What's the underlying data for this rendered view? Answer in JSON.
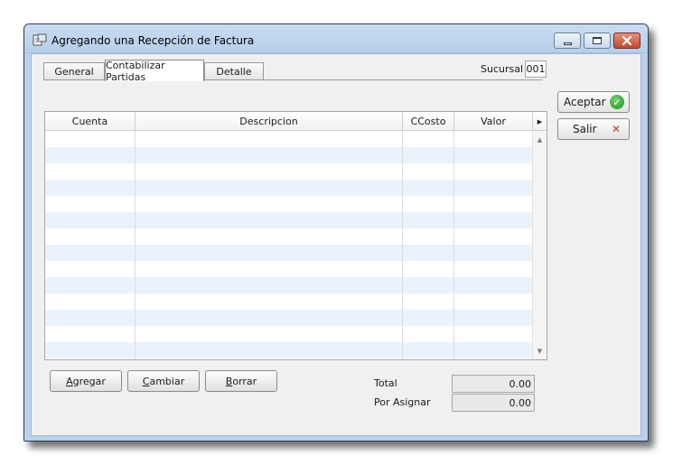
{
  "window": {
    "title": "Agregando una Recepción de Factura"
  },
  "tabs": [
    {
      "label": "General",
      "active": false
    },
    {
      "label": "Contabilizar Partidas",
      "active": true
    },
    {
      "label": "Detalle",
      "active": false
    }
  ],
  "sucursal": {
    "label": "Sucursal",
    "value": "001"
  },
  "actions": {
    "accept_label": "Aceptar",
    "exit_label": "Salir"
  },
  "grid": {
    "columns": [
      "Cuenta",
      "Descripcion",
      "CCosto",
      "Valor"
    ],
    "rows": []
  },
  "buttons": {
    "add": {
      "access_key": "A",
      "rest": "gregar"
    },
    "change": {
      "access_key": "C",
      "rest": "ambiar"
    },
    "delete": {
      "access_key": "B",
      "rest": "orrar"
    }
  },
  "totals": {
    "total_label": "Total",
    "total_value": "0.00",
    "unassigned_label": "Por Asignar",
    "unassigned_value": "0.00"
  },
  "icons": {
    "app": "app-icon",
    "accept": "check-icon",
    "exit": "close-x-icon"
  },
  "colors": {
    "title_bar": "#b9d1ea",
    "row_alt": "#eaf3fb",
    "accept_icon": "#1e8f1e",
    "exit_icon": "#c0392b"
  }
}
